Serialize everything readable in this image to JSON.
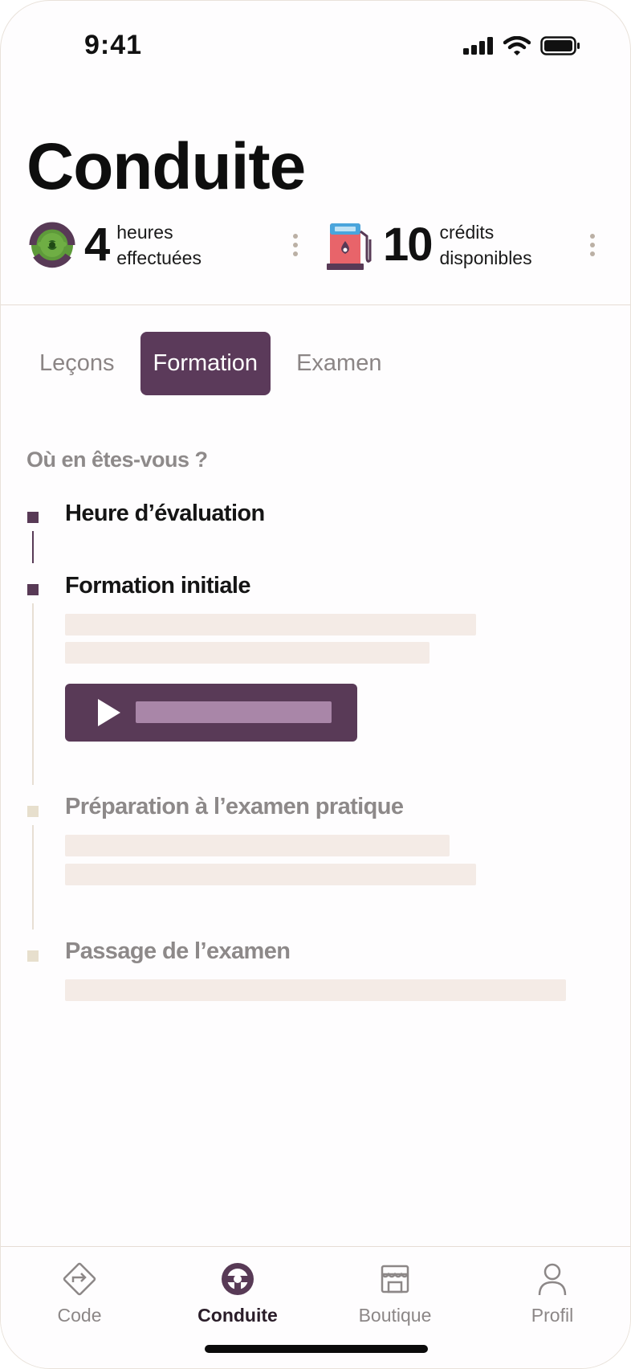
{
  "status_bar": {
    "time": "9:41"
  },
  "header": {
    "title": "Conduite"
  },
  "stats": {
    "hours": {
      "value": "4",
      "label_line1": "heures",
      "label_line2": "effectuées",
      "icon": "steering-wheel-icon"
    },
    "credits": {
      "value": "10",
      "label_line1": "crédits",
      "label_line2": "disponibles",
      "icon": "fuel-pump-icon"
    }
  },
  "tabs": [
    {
      "label": "Leçons",
      "active": false
    },
    {
      "label": "Formation",
      "active": true
    },
    {
      "label": "Examen",
      "active": false
    }
  ],
  "progress": {
    "question": "Où en êtes-vous ?",
    "steps": [
      {
        "title": "Heure d’évaluation",
        "state": "done"
      },
      {
        "title": "Formation initiale",
        "state": "done"
      },
      {
        "title": "Préparation à l’examen pratique",
        "state": "todo"
      },
      {
        "title": "Passage de l’examen",
        "state": "todo"
      }
    ]
  },
  "tab_bar": {
    "items": [
      {
        "label": "Code",
        "icon": "directions-sign-icon",
        "active": false
      },
      {
        "label": "Conduite",
        "icon": "steering-wheel-icon",
        "active": true
      },
      {
        "label": "Boutique",
        "icon": "store-icon",
        "active": false
      },
      {
        "label": "Profil",
        "icon": "user-icon",
        "active": false
      }
    ]
  },
  "colors": {
    "accent": "#5b3a5a",
    "accent_light": "#a986a8",
    "placeholder": "#f4ebe6",
    "todo_marker": "#e7dfcd"
  }
}
